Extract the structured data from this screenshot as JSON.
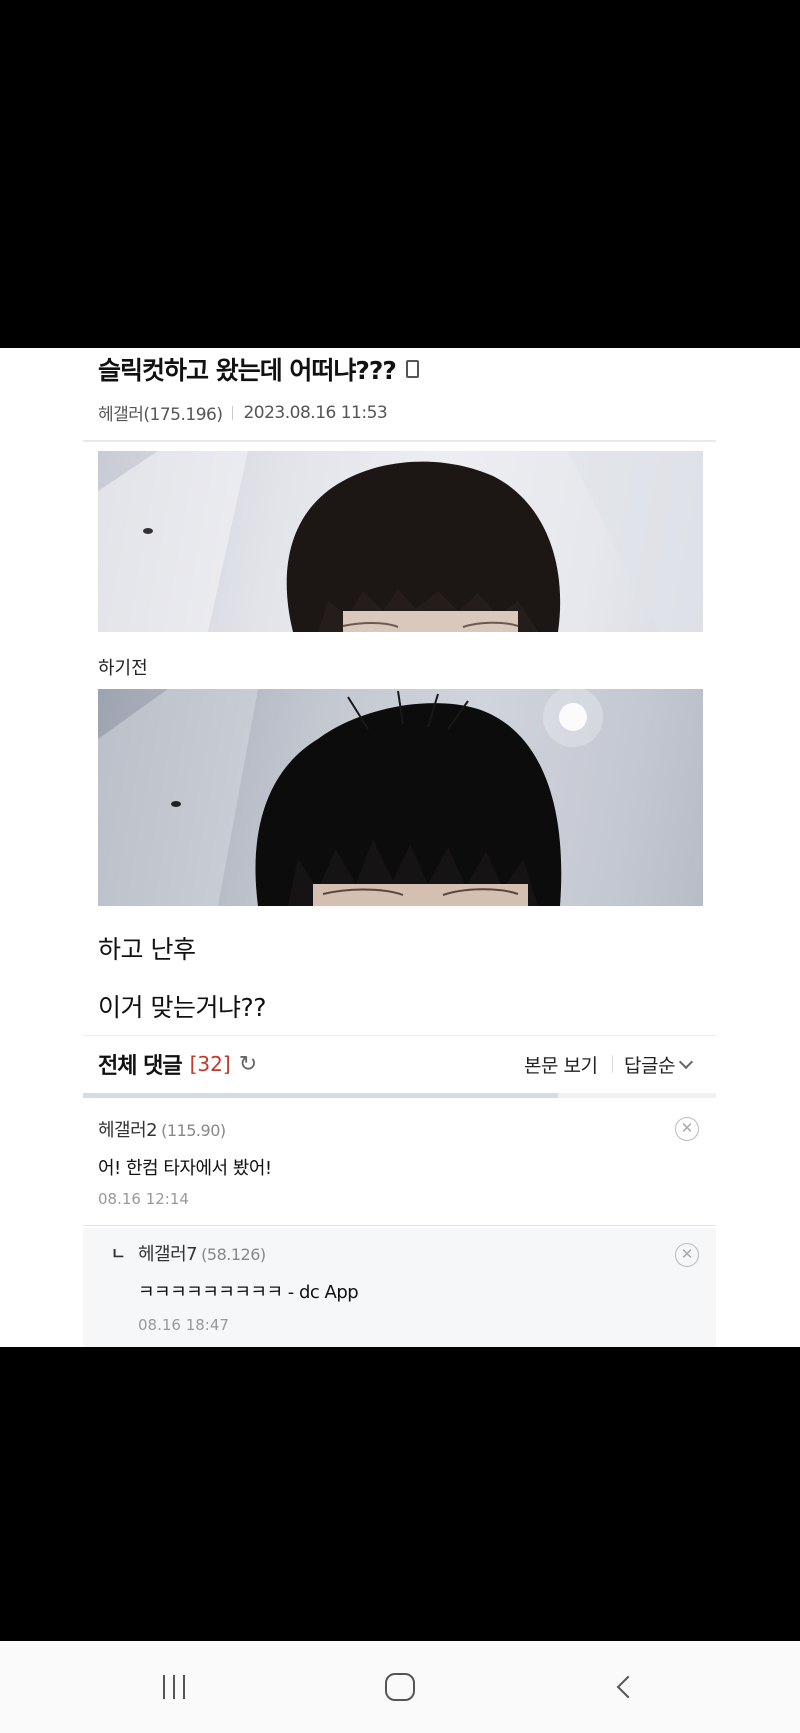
{
  "post": {
    "title": "슬릭컷하고 왔는데 어떠냐???",
    "author": "헤갤러(175.196)",
    "date": "2023.08.16 11:53",
    "caption_before": "하기전",
    "body_lines": [
      "하고 난후",
      "이거 맞는거냐??"
    ]
  },
  "comments_header": {
    "title": "전체 댓글",
    "count": "[32]",
    "view_body_label": "본문 보기",
    "sort_label": "답글순",
    "scroll_progress": 0.75
  },
  "comments": [
    {
      "author": "헤갤러2",
      "ip": "(115.90)",
      "text": "어! 한컴 타자에서 봤어!",
      "date": "08.16 12:14"
    },
    {
      "reply_marker": "ㄴ",
      "author": "헤갤러7",
      "ip": "(58.126)",
      "text": "ㅋㅋㅋㅋㅋㅋㅋㅋㅋ - dc App",
      "date": "08.16 18:47"
    }
  ],
  "icons": {
    "post_device": "mobile-phone-icon",
    "refresh": "refresh-icon",
    "sort": "chevron-down-icon",
    "delete": "close-circle-icon",
    "nav_recents": "recent-apps-icon",
    "nav_home": "home-icon",
    "nav_back": "back-icon"
  },
  "colors": {
    "comment_count": "#c0392b",
    "background_letterbox": "#000000"
  }
}
